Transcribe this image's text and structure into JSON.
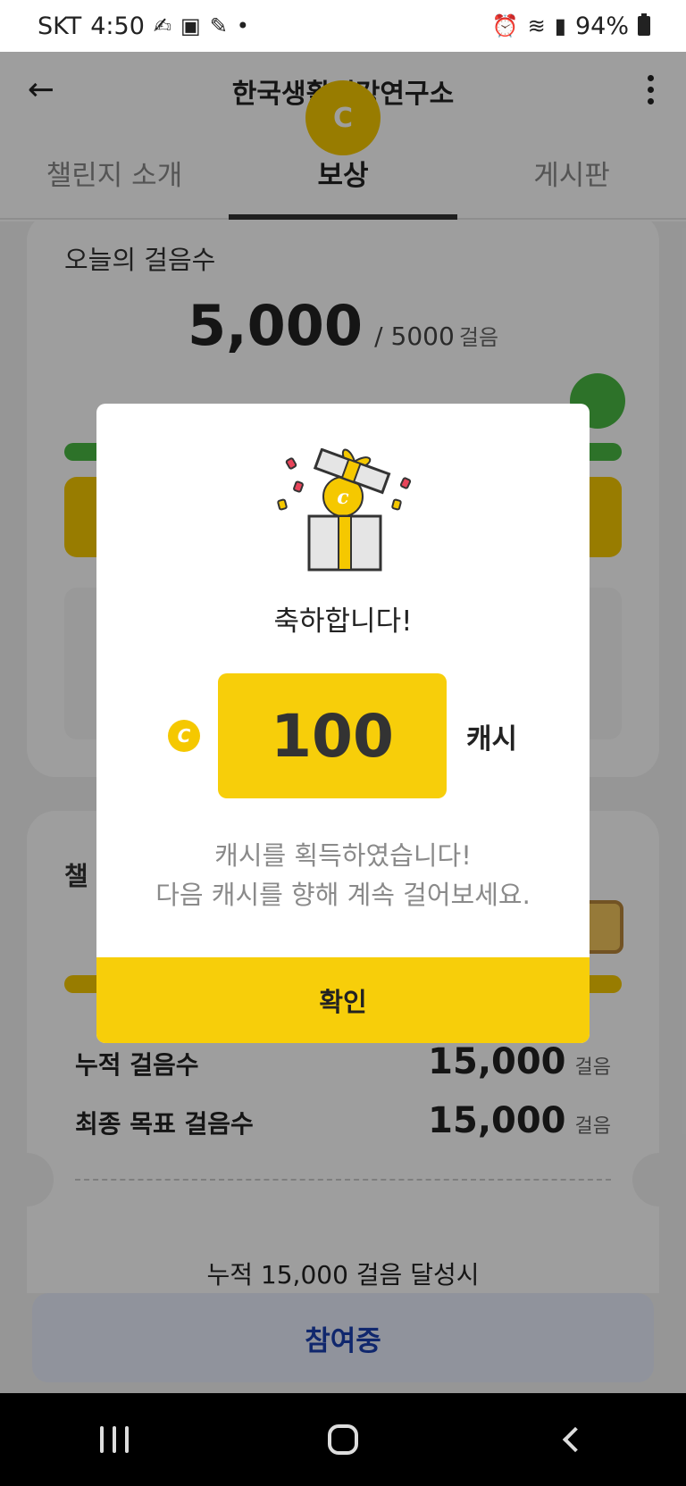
{
  "status_bar": {
    "carrier": "SKT",
    "time": "4:50",
    "battery": "94%",
    "left_icons": [
      "coin-app-icon",
      "image-icon",
      "pen-app-icon",
      "dot-icon"
    ],
    "right_icons": [
      "alarm-icon",
      "wifi-icon",
      "signal-icon",
      "battery-icon"
    ]
  },
  "header": {
    "title": "한국생활건강연구소",
    "back_icon": "arrow-left-icon",
    "more_icon": "more-vertical-icon",
    "coin_glyph": "C"
  },
  "tabs": [
    {
      "label": "챌린지 소개",
      "active": false
    },
    {
      "label": "보상",
      "active": true
    },
    {
      "label": "게시판",
      "active": false
    }
  ],
  "today_steps": {
    "label": "오늘의 걸음수",
    "value": "5,000",
    "goal": "/ 5000",
    "unit": "걸음",
    "progress": 1.0
  },
  "challenge": {
    "label": "챌",
    "accumulated_label": "누적 걸음수",
    "accumulated_value": "15,000",
    "final_goal_label": "최종 목표 걸음수",
    "final_goal_value": "15,000",
    "unit": "걸음",
    "milestone_text": "누적 15,000 걸음 달성시"
  },
  "join_button": {
    "label": "참여중"
  },
  "modal": {
    "title": "축하합니다!",
    "coin_glyph": "C",
    "amount": "100",
    "amount_unit": "캐시",
    "message_line1": "캐시를 획득하였습니다!",
    "message_line2": "다음 캐시를 향해 계속 걸어보세요.",
    "confirm_label": "확인",
    "gift_icon": "gift-box-icon"
  },
  "colors": {
    "accent_yellow": "#f7ce0a",
    "progress_green": "#49b843",
    "join_text": "#1b3fb0",
    "overlay": "rgba(0,0,0,0.38)"
  },
  "nav": [
    "recent-apps-icon",
    "home-icon",
    "back-icon"
  ]
}
